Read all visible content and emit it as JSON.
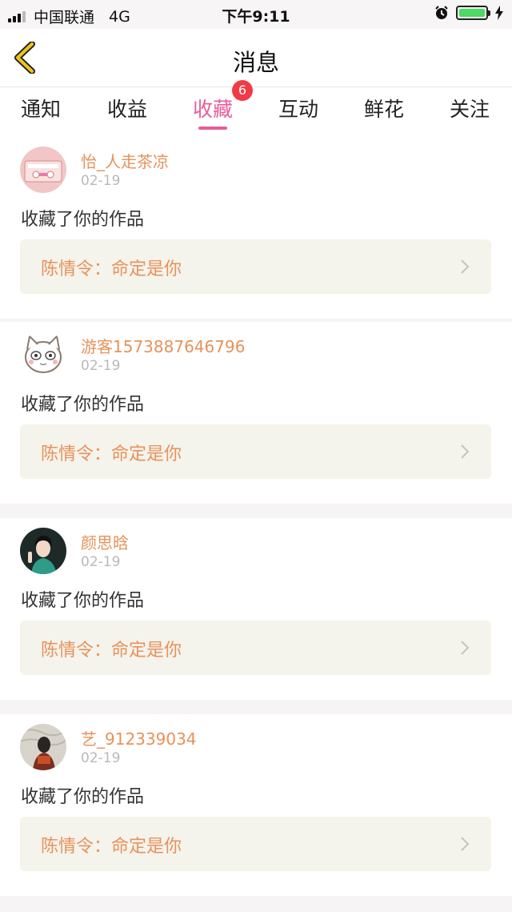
{
  "status_bar": {
    "carrier": "中国联通",
    "network": "4G",
    "time": "下午9:11",
    "battery_color": "#4cd964"
  },
  "header": {
    "back_icon": "chevron-left-icon",
    "title": "消息",
    "back_color": "#f0c419"
  },
  "tabs": [
    {
      "label": "通知"
    },
    {
      "label": "收益"
    },
    {
      "label": "收藏",
      "active": true,
      "badge": "6"
    },
    {
      "label": "互动"
    },
    {
      "label": "鲜花"
    },
    {
      "label": "关注"
    }
  ],
  "accent_color": "#e85d9c",
  "name_color": "#e8925a",
  "messages": [
    {
      "username": "怡_人走茶凉",
      "date": "02-19",
      "action": "收藏了你的作品",
      "work": "陈情令：命定是你"
    },
    {
      "username": "游客1573887646796",
      "date": "02-19",
      "action": "收藏了你的作品",
      "work": "陈情令：命定是你"
    },
    {
      "username": "颜思晗",
      "date": "02-19",
      "action": "收藏了你的作品",
      "work": "陈情令：命定是你"
    },
    {
      "username": "艺_912339034",
      "date": "02-19",
      "action": "收藏了你的作品",
      "work": "陈情令：命定是你"
    }
  ]
}
